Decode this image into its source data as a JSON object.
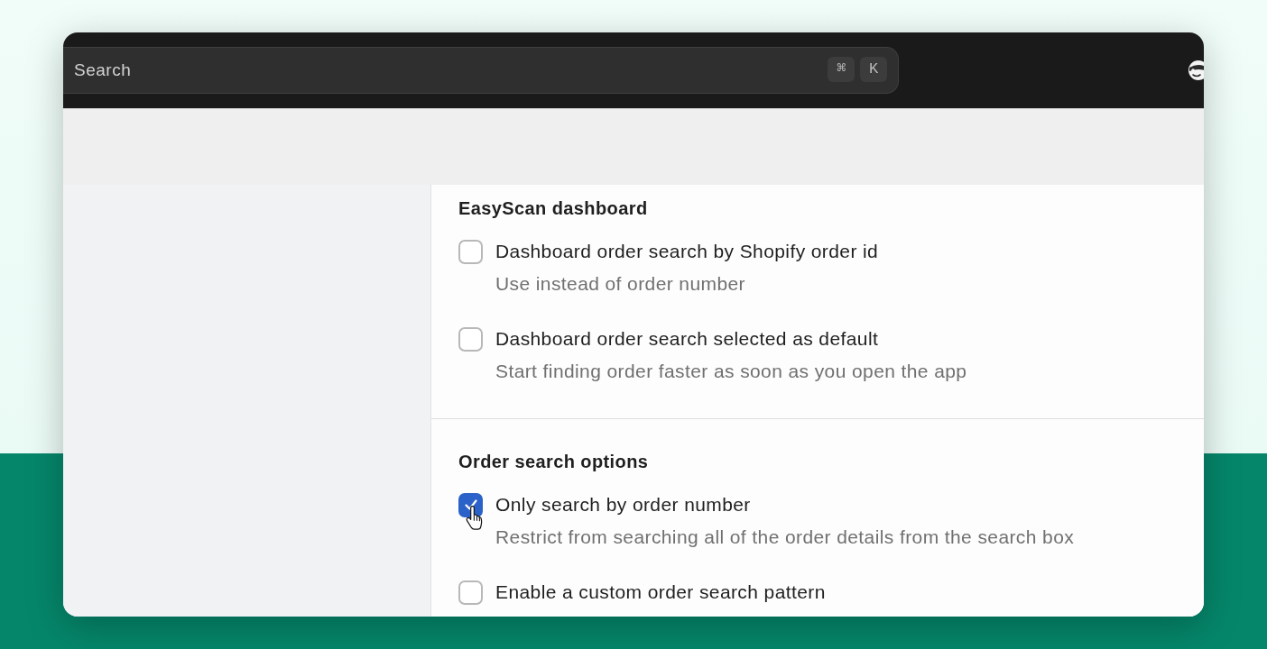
{
  "search": {
    "placeholder": "Search",
    "shortcut_keys": [
      "⌘",
      "K"
    ]
  },
  "sections": [
    {
      "title": "EasyScan dashboard",
      "options": [
        {
          "label": "Dashboard order search by Shopify order id",
          "description": "Use instead of order number",
          "checked": false
        },
        {
          "label": "Dashboard order search selected as default",
          "description": "Start finding order faster as soon as you open the app",
          "checked": false
        }
      ]
    },
    {
      "title": "Order search options",
      "options": [
        {
          "label": "Only search by order number",
          "description": "Restrict from searching all of the order details from the search box",
          "checked": true
        },
        {
          "label": "Enable a custom order search pattern",
          "checked": false
        }
      ]
    }
  ]
}
